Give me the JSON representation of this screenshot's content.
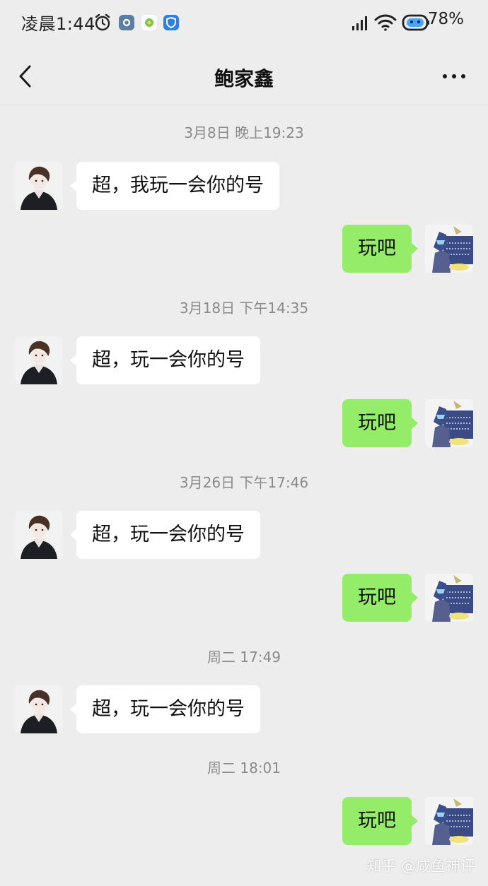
{
  "status_bar": {
    "time": "凌晨1:44",
    "battery": "78%",
    "icons": [
      "alarm-icon",
      "settings-app-icon",
      "green-app-icon",
      "shield-app-icon",
      "signal-icon",
      "wifi-icon",
      "robot-icon"
    ]
  },
  "nav": {
    "title": "鲍家鑫",
    "back_icon": "chevron-left-icon",
    "more_icon": "more-dots-icon"
  },
  "messages": [
    {
      "type": "timestamp",
      "text": "3月8日 晚上19:23"
    },
    {
      "type": "incoming",
      "text": "超，我玩一会你的号"
    },
    {
      "type": "outgoing",
      "text": "玩吧"
    },
    {
      "type": "timestamp",
      "text": "3月18日 下午14:35"
    },
    {
      "type": "incoming",
      "text": "超，玩一会你的号"
    },
    {
      "type": "outgoing",
      "text": "玩吧"
    },
    {
      "type": "timestamp",
      "text": "3月26日 下午17:46"
    },
    {
      "type": "incoming",
      "text": "超，玩一会你的号"
    },
    {
      "type": "outgoing",
      "text": "玩吧"
    },
    {
      "type": "timestamp",
      "text": "周二 17:49"
    },
    {
      "type": "incoming",
      "text": "超，玩一会你的号"
    },
    {
      "type": "timestamp",
      "text": "周二 18:01"
    },
    {
      "type": "outgoing",
      "text": "玩吧"
    }
  ],
  "watermark": "知乎 @咸鱼神评",
  "colors": {
    "background": "#ededed",
    "outgoing_bubble": "#95ec69",
    "incoming_bubble": "#ffffff",
    "timestamp_text": "#8a8a8a"
  }
}
